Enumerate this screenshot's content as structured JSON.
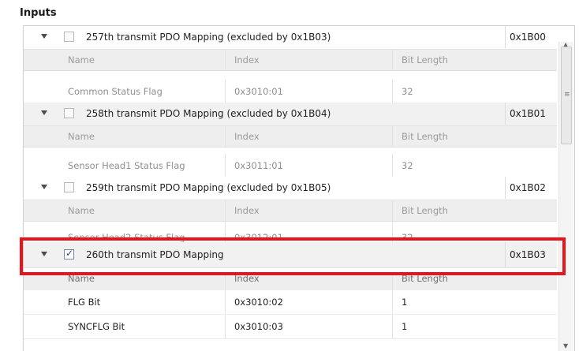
{
  "title": "Inputs",
  "columns": {
    "name": "Name",
    "index": "Index",
    "bit_length": "Bit Length"
  },
  "groups": [
    {
      "label": "257th transmit PDO Mapping (excluded by 0x1B03)",
      "index": "0x1B00",
      "checked": false,
      "rows": [
        {
          "name": "Common Status Flag",
          "index": "0x3010:01",
          "bit_length": "32"
        }
      ]
    },
    {
      "label": "258th transmit PDO Mapping (excluded by 0x1B04)",
      "index": "0x1B01",
      "checked": false,
      "rows": [
        {
          "name": "Sensor Head1 Status Flag",
          "index": "0x3011:01",
          "bit_length": "32"
        }
      ]
    },
    {
      "label": "259th transmit PDO Mapping (excluded by 0x1B05)",
      "index": "0x1B02",
      "checked": false,
      "rows": [
        {
          "name": "Sensor Head2 Status Flag",
          "index": "0x3012:01",
          "bit_length": "32"
        }
      ]
    },
    {
      "label": "260th transmit PDO Mapping",
      "index": "0x1B03",
      "checked": true,
      "rows": [
        {
          "name": "FLG Bit",
          "index": "0x3010:02",
          "bit_length": "1"
        },
        {
          "name": "SYNCFLG Bit",
          "index": "0x3010:03",
          "bit_length": "1"
        }
      ]
    }
  ],
  "icons": {
    "expand": "chevron-down-icon",
    "check": "checkbox-icon"
  },
  "highlight_color": "#e8141b"
}
